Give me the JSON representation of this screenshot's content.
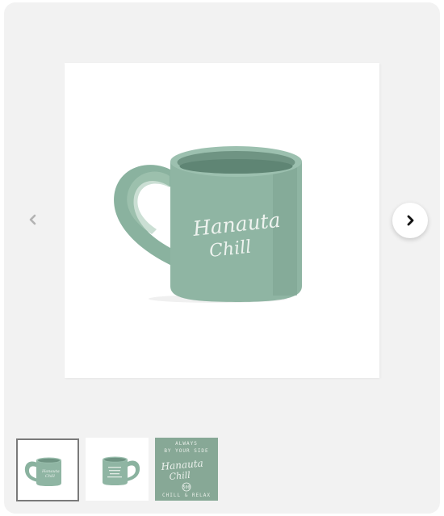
{
  "gallery": {
    "main_image": {
      "subject": "mug",
      "mug_color": "#8fb5a3",
      "logo_line1": "Hanauta",
      "logo_line2": "Chill"
    },
    "nav": {
      "prev_icon": "chevron-left-icon",
      "next_icon": "chevron-right-icon"
    },
    "thumbnails": [
      {
        "active": true,
        "logo_line1": "Hanauta",
        "logo_line2": "Chill"
      },
      {
        "active": false
      },
      {
        "active": false,
        "logo_line1": "Hanauta",
        "logo_line2": "Chill",
        "seal_number": "500",
        "caption_top_1": "ALWAYS",
        "caption_top_2": "BY YOUR SIDE",
        "caption_bottom": "CHILL & RELAX",
        "bg_color": "#87a896"
      }
    ]
  }
}
